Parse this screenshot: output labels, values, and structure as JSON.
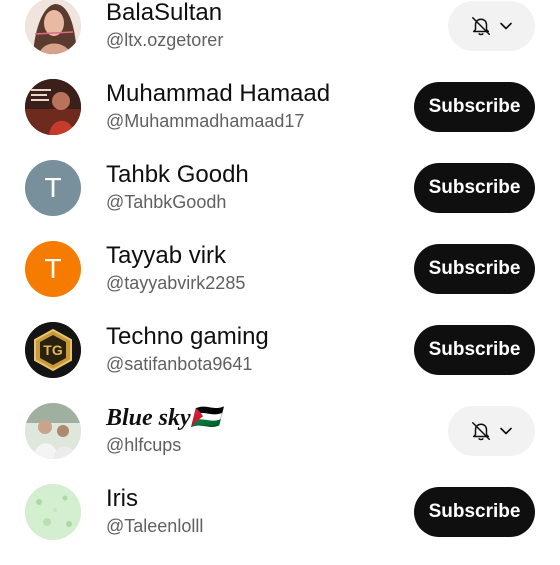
{
  "subscribe_label": "Subscribe",
  "channels": [
    {
      "name": "BalaSultan",
      "handle": "@ltx.ozgetorer",
      "state": "subscribed"
    },
    {
      "name": "Muhammad Hamaad",
      "handle": "@Muhammadhamaad17",
      "state": "not_subscribed"
    },
    {
      "name": "Tahbk Goodh",
      "handle": "@TahbkGoodh",
      "state": "not_subscribed",
      "avatar_letter": "T",
      "avatar_color": "#78909c"
    },
    {
      "name": "Tayyab virk",
      "handle": "@tayyabvirk2285",
      "state": "not_subscribed",
      "avatar_letter": "T",
      "avatar_color": "#f57c00"
    },
    {
      "name": "Techno gaming",
      "handle": "@satifanbota9641",
      "state": "not_subscribed",
      "avatar_letter": "TG"
    },
    {
      "name": "Blue sky🇵🇸",
      "handle": "@hlfcups",
      "state": "subscribed"
    },
    {
      "name": "Iris",
      "handle": "@Taleenlolll",
      "state": "not_subscribed"
    }
  ],
  "colors": {
    "subscribe_bg": "#0f0f0f",
    "subscribed_bg": "#f2f2f2",
    "handle_text": "#606060"
  },
  "icons": {
    "subscribed": "bell-off-icon",
    "dropdown": "chevron-down-icon"
  }
}
